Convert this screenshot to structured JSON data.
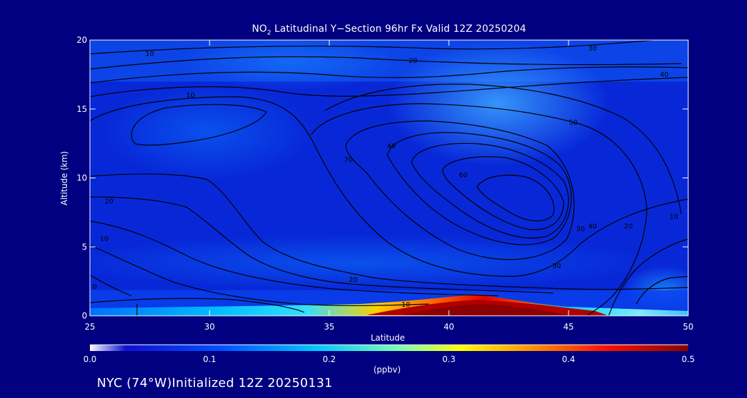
{
  "chart_data": {
    "type": "heatmap",
    "title_prefix": "NO",
    "title_sub": "2",
    "title_suffix": " Latitudinal Y−Section 96hr  Fx Valid 12Z 20250204",
    "xlabel": "Latitude",
    "ylabel": "Altitude (km)",
    "xlim": [
      25,
      50
    ],
    "ylim": [
      0,
      20
    ],
    "x_ticks": [
      25,
      30,
      35,
      40,
      45,
      50
    ],
    "y_ticks": [
      0,
      5,
      10,
      15,
      20
    ],
    "colorbar": {
      "min": 0.0,
      "max": 0.5,
      "ticks": [
        "0.0",
        "0.1",
        "0.2",
        "0.3",
        "0.4",
        "0.5"
      ],
      "unit": "(ppbv)",
      "colors": [
        "#ffffff",
        "#0000cc",
        "#0066ff",
        "#00ccff",
        "#66ffcc",
        "#ffff00",
        "#ff8800",
        "#ff0000",
        "#8b0000"
      ]
    },
    "contour_labels": [
      {
        "text": "10",
        "x": 27.5,
        "y": 19.0
      },
      {
        "text": "20",
        "x": 38.5,
        "y": 18.5
      },
      {
        "text": "30",
        "x": 46.0,
        "y": 19.4
      },
      {
        "text": "40",
        "x": 49.0,
        "y": 17.5
      },
      {
        "text": "10",
        "x": 29.2,
        "y": 16.0
      },
      {
        "text": "50",
        "x": 45.2,
        "y": 14.0
      },
      {
        "text": "40",
        "x": 37.6,
        "y": 12.3
      },
      {
        "text": "70",
        "x": 35.8,
        "y": 11.3
      },
      {
        "text": "60",
        "x": 40.6,
        "y": 10.2
      },
      {
        "text": "20",
        "x": 25.8,
        "y": 8.3
      },
      {
        "text": "10",
        "x": 25.6,
        "y": 5.6
      },
      {
        "text": "30",
        "x": 45.5,
        "y": 6.3
      },
      {
        "text": "40",
        "x": 46.0,
        "y": 6.5
      },
      {
        "text": "20",
        "x": 47.5,
        "y": 6.5
      },
      {
        "text": "10",
        "x": 49.4,
        "y": 7.2
      },
      {
        "text": "30",
        "x": 44.5,
        "y": 3.6
      },
      {
        "text": "20",
        "x": 36.0,
        "y": 2.6
      },
      {
        "text": "10",
        "x": 38.2,
        "y": 0.8
      },
      {
        "text": "0",
        "x": 25.2,
        "y": 2.1
      }
    ],
    "grid": false
  },
  "footer": "NYC (74°W)Initialized 12Z 20250131"
}
